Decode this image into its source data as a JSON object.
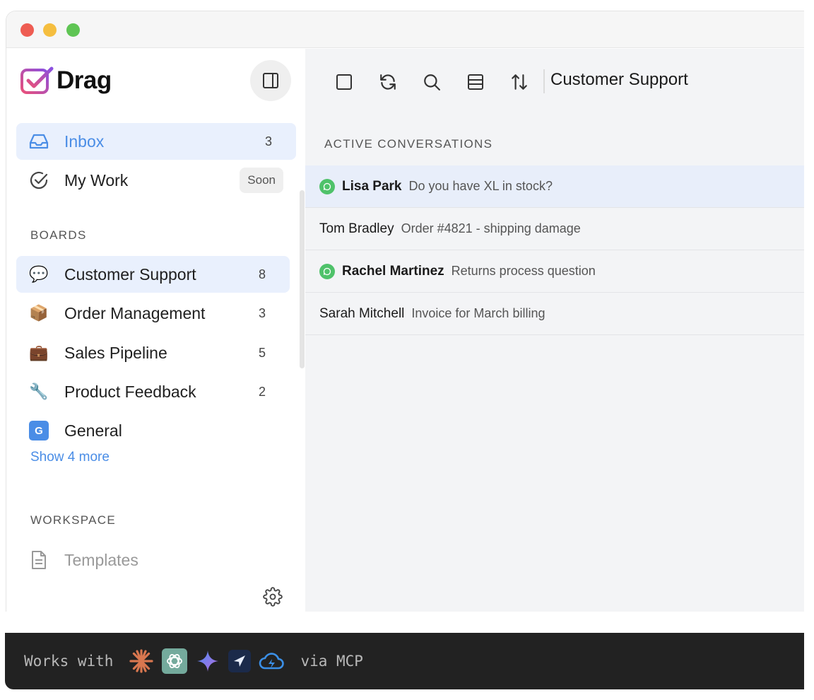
{
  "app": {
    "name": "Drag"
  },
  "sidebar": {
    "primary": [
      {
        "label": "Inbox",
        "count": "3",
        "icon": "inbox-icon",
        "active": true
      },
      {
        "label": "My Work",
        "badge": "Soon",
        "icon": "check-circle-icon"
      }
    ],
    "boards_title": "BOARDS",
    "boards": [
      {
        "label": "Customer Support",
        "count": "8",
        "icon": "💬"
      },
      {
        "label": "Order Management",
        "count": "3",
        "icon": "📦"
      },
      {
        "label": "Sales Pipeline",
        "count": "5",
        "icon": "💼"
      },
      {
        "label": "Product Feedback",
        "count": "2",
        "icon": "🔧"
      },
      {
        "label": "General",
        "icon": "G"
      }
    ],
    "show_more": "Show 4 more",
    "workspace_title": "WORKSPACE",
    "workspace": [
      {
        "label": "Templates",
        "icon": "document-icon"
      }
    ]
  },
  "main": {
    "title": "Customer Support",
    "section_title": "ACTIVE CONVERSATIONS",
    "toolbar": [
      "select-all-icon",
      "refresh-icon",
      "search-icon",
      "layout-icon",
      "sort-icon"
    ],
    "conversations": [
      {
        "name": "Lisa Park",
        "preview": "Do you have XL in stock?",
        "unread": true,
        "selected": true
      },
      {
        "name": "Tom Bradley",
        "preview": "Order #4821 - shipping damage",
        "unread": false
      },
      {
        "name": "Rachel Martinez",
        "preview": "Returns process question",
        "unread": true
      },
      {
        "name": "Sarah Mitchell",
        "preview": "Invoice for March billing",
        "unread": false
      }
    ]
  },
  "footer": {
    "prefix": "Works with",
    "suffix": "via MCP",
    "icons": [
      "claude-icon",
      "openai-icon",
      "gemini-icon",
      "paper-plane-icon",
      "cloud-icon"
    ]
  },
  "colors": {
    "accent": "#4a8de6",
    "active_bg": "#e9f0fd",
    "unread_dot": "#4fc26a",
    "footer_bg": "#222222"
  }
}
